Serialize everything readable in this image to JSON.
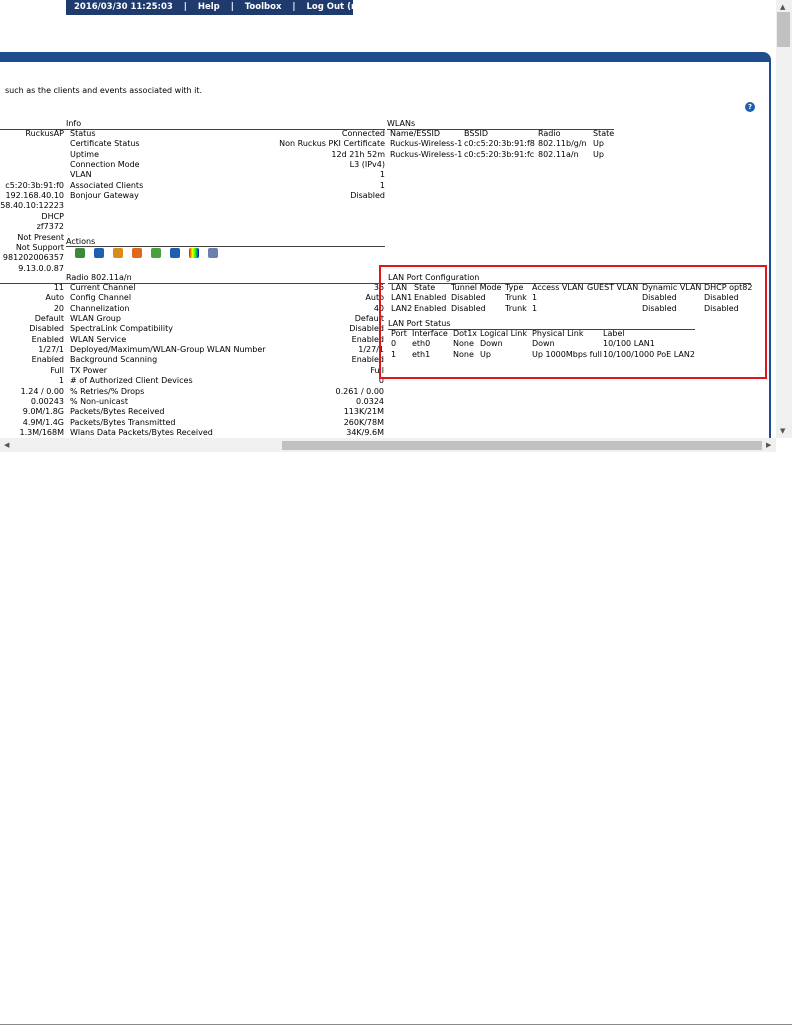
{
  "topnav": {
    "datetime": "2016/03/30  11:25:03",
    "help": "Help",
    "toolbox": "Toolbox",
    "logout": "Log Out (ruckus)",
    "sep": "|"
  },
  "description": "such as the clients and events associated with it.",
  "left_values": [
    "RuckusAP",
    "",
    "",
    "",
    "",
    "c5:20:3b:91:f0",
    "192.168.40.10",
    "58.40.10:12223",
    "DHCP",
    "zf7372",
    "Not Present",
    "Not Support",
    "981202006357",
    "9.13.0.0.87"
  ],
  "info": {
    "title": "Info",
    "rows": [
      {
        "label": "Status",
        "value": "Connected"
      },
      {
        "label": "Certificate Status",
        "value": "Non Ruckus PKI Certificate"
      },
      {
        "label": "Uptime",
        "value": "12d 21h 52m"
      },
      {
        "label": "Connection Mode",
        "value": "L3 (IPv4)"
      },
      {
        "label": "VLAN",
        "value": "1"
      },
      {
        "label": "Associated Clients",
        "value": "1"
      },
      {
        "label": "Bonjour Gateway",
        "value": "Disabled"
      }
    ]
  },
  "wlans": {
    "title": "WLANs",
    "headers": [
      "Name/ESSID",
      "BSSID",
      "Radio",
      "State"
    ],
    "rows": [
      [
        "Ruckus-Wireless-1",
        "c0:c5:20:3b:91:f8",
        "802.11b/g/n",
        "Up"
      ],
      [
        "Ruckus-Wireless-1",
        "c0:c5:20:3b:91:fc",
        "802.11a/n",
        "Up"
      ]
    ]
  },
  "actions": {
    "title": "Actions",
    "icons": [
      "map-icon",
      "refresh-icon",
      "edit-icon",
      "restart-icon",
      "speedflex-icon",
      "sync-icon",
      "spectrum-icon",
      "chart-icon"
    ]
  },
  "radio": {
    "title": "Radio 802.11a/n",
    "left_values": [
      "11",
      "Auto",
      "20",
      "Default",
      "Disabled",
      "Enabled",
      "1/27/1",
      "Enabled",
      "Full",
      "1",
      "1.24 / 0.00",
      "0.00243",
      "9.0M/1.8G",
      "4.9M/1.4G",
      "1.3M/168M"
    ],
    "rows": [
      {
        "label": "Current Channel",
        "value": "36"
      },
      {
        "label": "Config Channel",
        "value": "Auto"
      },
      {
        "label": "Channelization",
        "value": "40"
      },
      {
        "label": "WLAN Group",
        "value": "Default"
      },
      {
        "label": "SpectraLink Compatibility",
        "value": "Disabled"
      },
      {
        "label": "WLAN Service",
        "value": "Enabled"
      },
      {
        "label": "Deployed/Maximum/WLAN-Group WLAN Number",
        "value": "1/27/1"
      },
      {
        "label": "Background Scanning",
        "value": "Enabled"
      },
      {
        "label": "TX Power",
        "value": "Full"
      },
      {
        "label": "# of Authorized Client Devices",
        "value": "0"
      },
      {
        "label": "% Retries/% Drops",
        "value": "0.261 / 0.00"
      },
      {
        "label": "% Non-unicast",
        "value": "0.0324"
      },
      {
        "label": "Packets/Bytes Received",
        "value": "113K/21M"
      },
      {
        "label": "Packets/Bytes Transmitted",
        "value": "260K/78M"
      },
      {
        "label": "Wlans Data Packets/Bytes Received",
        "value": "34K/9.6M"
      }
    ]
  },
  "lan_config": {
    "title": "LAN Port Configuration",
    "headers": [
      "LAN",
      "State",
      "Tunnel Mode",
      "Type",
      "Access VLAN",
      "GUEST VLAN",
      "Dynamic VLAN",
      "DHCP opt82"
    ],
    "rows": [
      [
        "LAN1",
        "Enabled",
        "Disabled",
        "Trunk",
        "1",
        "",
        "Disabled",
        "Disabled"
      ],
      [
        "LAN2",
        "Enabled",
        "Disabled",
        "Trunk",
        "1",
        "",
        "Disabled",
        "Disabled"
      ]
    ]
  },
  "lan_status": {
    "title": "LAN Port Status",
    "headers": [
      "Port",
      "Interface",
      "Dot1x",
      "Logical Link",
      "Physical Link",
      "Label"
    ],
    "rows": [
      [
        "0",
        "eth0",
        "None",
        "Down",
        "Down",
        "10/100 LAN1"
      ],
      [
        "1",
        "eth1",
        "None",
        "Up",
        "Up 1000Mbps full",
        "10/100/1000 PoE LAN2"
      ]
    ]
  },
  "colors": {
    "nav_bg": "#1f3b6e",
    "highlight": "#e0161f",
    "bar": "#1f4e8c"
  }
}
